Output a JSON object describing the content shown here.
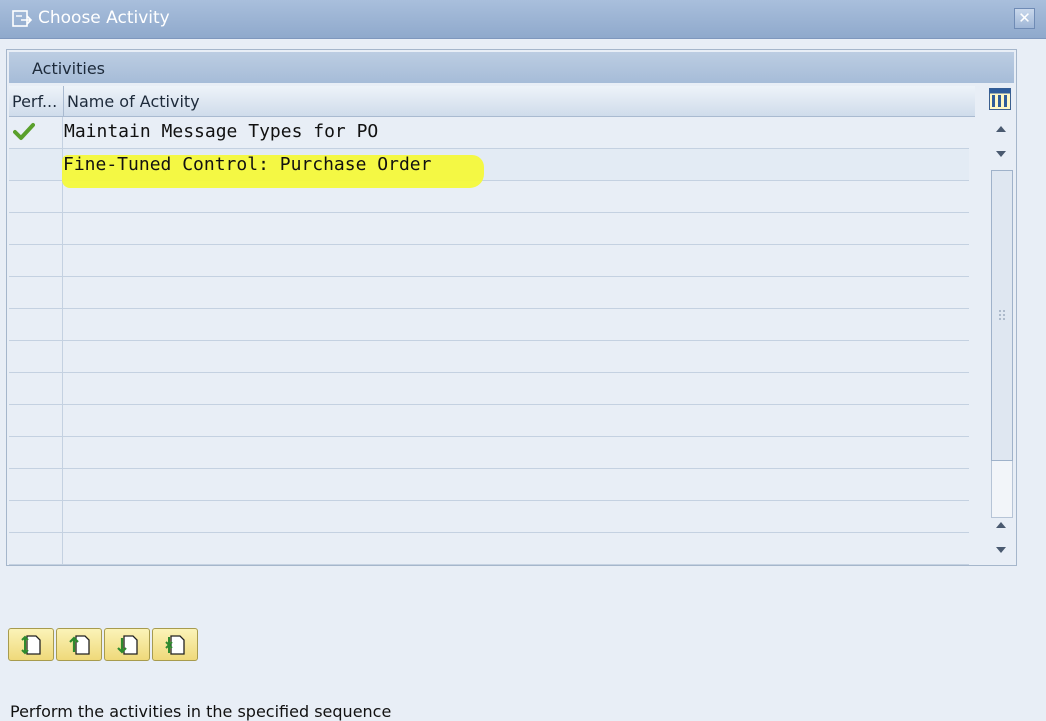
{
  "window": {
    "title": "Choose Activity",
    "title_icon": "choose-activity-icon",
    "close_icon": "close-icon"
  },
  "panel": {
    "title": "Activities",
    "columns": [
      "Perf...",
      "Name of Activity"
    ],
    "column_settings_icon": "table-settings-icon",
    "rows": [
      {
        "performed_icon": "checkmark-icon",
        "name": "Maintain Message Types for PO",
        "highlighted": false
      },
      {
        "performed_icon": "",
        "name": "Fine-Tuned Control: Purchase Order",
        "highlighted": true
      }
    ]
  },
  "toolbar": {
    "buttons": [
      "select-all-icon",
      "move-up-icon",
      "move-down-icon",
      "deselect-all-icon"
    ]
  },
  "status": {
    "text": "Perform the activities in the specified sequence"
  },
  "colors": {
    "titlebar": "#8fa9cc",
    "highlight": "#f4f93a",
    "check": "#5aa02c",
    "button": "#efd97a"
  }
}
